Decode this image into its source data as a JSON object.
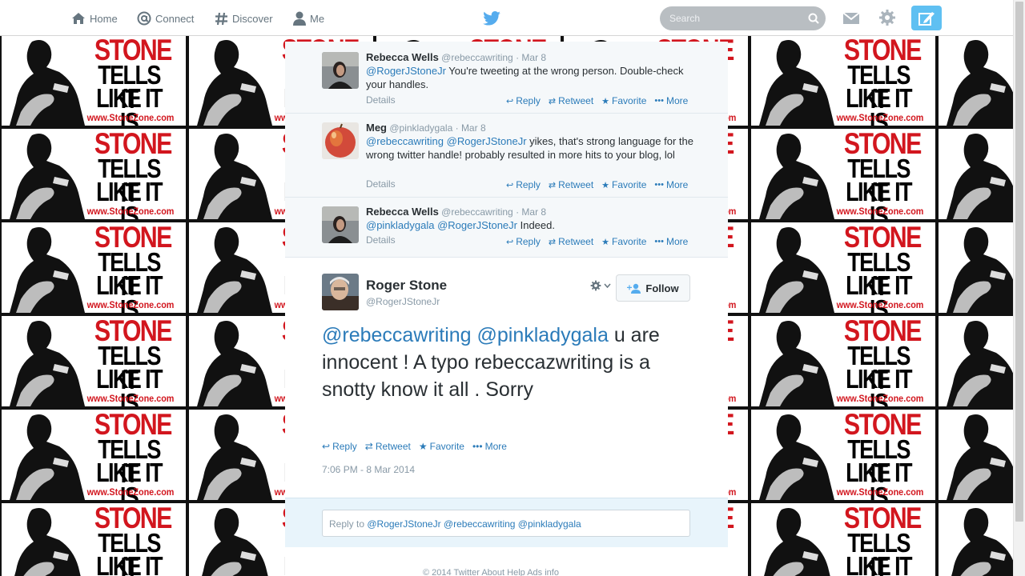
{
  "nav": {
    "home": "Home",
    "connect": "Connect",
    "discover": "Discover",
    "me": "Me",
    "search_placeholder": "Search"
  },
  "wallpaper": {
    "line1": "STONE",
    "line2": "TELLS IT",
    "line3": "LIKE IT IS",
    "line4": "www.StoneZone.com"
  },
  "tweets": [
    {
      "name": "Rebecca Wells",
      "handle": "@rebeccawriting",
      "date": "Mar 8",
      "mentions": "@RogerJStoneJr",
      "text": " You're tweeting at the wrong person. Double-check your handles.",
      "details": "Details"
    },
    {
      "name": "Meg",
      "handle": "@pinkladygala",
      "date": "Mar 8",
      "mentions": "@rebeccawriting @RogerJStoneJr",
      "text": " yikes, that's strong language for the wrong twitter handle!  probably resulted in more hits to your blog, lol",
      "details": "Details"
    },
    {
      "name": "Rebecca Wells",
      "handle": "@rebeccawriting",
      "date": "Mar 8",
      "mentions": "@pinkladygala @RogerJStoneJr",
      "text": " Indeed.",
      "details": "Details"
    }
  ],
  "actions": {
    "reply": "Reply",
    "retweet": "Retweet",
    "favorite": "Favorite",
    "more": "More"
  },
  "main": {
    "name": "Roger Stone",
    "handle": "@RogerJStoneJr",
    "follow": "Follow",
    "mentions": "@rebeccawriting @pinkladygala",
    "text": " u are innocent ! A typo rebeccazwriting is a snotty know it all . Sorry",
    "time": "7:06 PM - 8 Mar 2014"
  },
  "reply_box": {
    "prefix": "Reply to ",
    "mentions": "@RogerJStoneJr @rebeccawriting @pinkladygala"
  },
  "footer": "© 2014 Twitter   About   Help   Ads info",
  "colors": {
    "link": "#2b7bb9",
    "twitter_blue": "#55acee",
    "compose_bg": "#5fc0f2",
    "wallpaper_red": "#d2161e"
  }
}
